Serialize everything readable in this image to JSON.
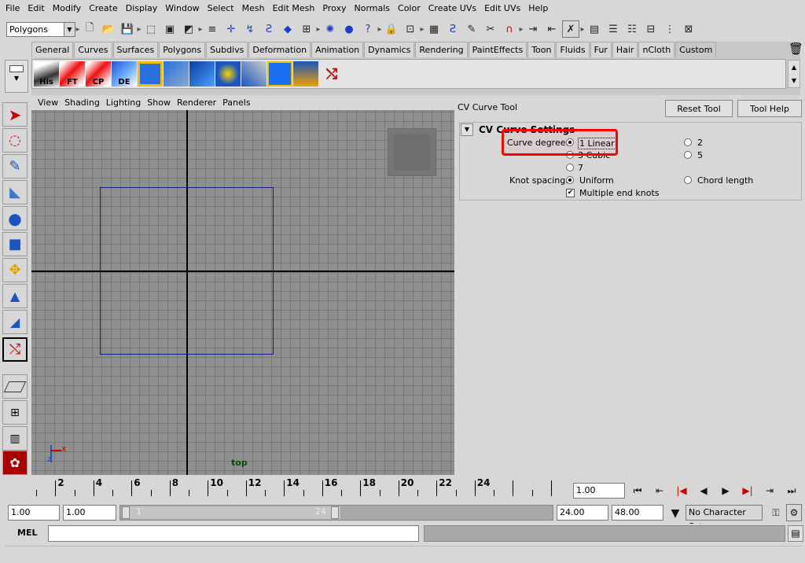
{
  "menubar": [
    "File",
    "Edit",
    "Modify",
    "Create",
    "Display",
    "Window",
    "Select",
    "Mesh",
    "Edit Mesh",
    "Proxy",
    "Normals",
    "Color",
    "Create UVs",
    "Edit UVs",
    "Help"
  ],
  "statusline": {
    "mode": "Polygons"
  },
  "shelf": {
    "tabs": [
      "General",
      "Curves",
      "Surfaces",
      "Polygons",
      "Subdivs",
      "Deformation",
      "Animation",
      "Dynamics",
      "Rendering",
      "PaintEffects",
      "Toon",
      "Fluids",
      "Fur",
      "Hair",
      "nCloth",
      "Custom"
    ],
    "active_tab": "Custom",
    "buttons": [
      {
        "label": "His"
      },
      {
        "label": "FT"
      },
      {
        "label": "CP"
      },
      {
        "label": "DE"
      },
      {
        "label": ""
      },
      {
        "label": ""
      },
      {
        "label": ""
      },
      {
        "label": ""
      },
      {
        "label": ""
      },
      {
        "label": ""
      },
      {
        "label": ""
      },
      {
        "label": ""
      }
    ]
  },
  "panel": {
    "menu": [
      "View",
      "Shading",
      "Lighting",
      "Show",
      "Renderer",
      "Panels"
    ],
    "camera_label": "top",
    "axis_x": "x",
    "axis_z": "z"
  },
  "tool": {
    "title": "CV Curve Tool",
    "reset_label": "Reset Tool",
    "help_label": "Tool Help",
    "section_title": "CV Curve Settings",
    "curve_degree_label": "Curve degree:",
    "degree_options": [
      "1 Linear",
      "2",
      "3 Cubic",
      "5",
      "7"
    ],
    "degree_selected": "1 Linear",
    "knot_spacing_label": "Knot spacing:",
    "knot_options": [
      "Uniform",
      "Chord length"
    ],
    "knot_selected": "Uniform",
    "multiple_end_knots_label": "Multiple end knots",
    "multiple_end_knots": true,
    "highlight_color": "#ff0000"
  },
  "timeline": {
    "current_frame": "1",
    "ticks": [
      "2",
      "4",
      "6",
      "8",
      "10",
      "12",
      "14",
      "16",
      "18",
      "20",
      "22",
      "24"
    ],
    "current_time": "1.00"
  },
  "range": {
    "start": "1.00",
    "playback_start": "1.00",
    "slider_start": "1",
    "slider_end": "24",
    "playback_end": "24.00",
    "end": "48.00",
    "character_set": "No Character Set"
  },
  "commandline": {
    "label": "MEL"
  }
}
